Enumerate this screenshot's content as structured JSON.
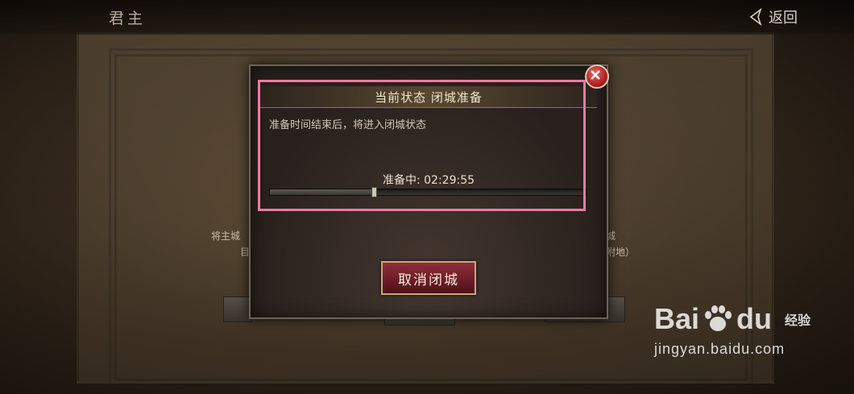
{
  "topbar": {
    "title": "君主",
    "back_label": "返回"
  },
  "background": {
    "left_text_1": "将主城",
    "left_text_2": "目",
    "right_text_1": "城",
    "right_text_2": "附地）"
  },
  "dialog": {
    "header": "当前状态 闭城准备",
    "description": "准备时间结束后，将进入闭城状态",
    "progress_label": "准备中: 02:29:55",
    "progress_fraction": 0.33,
    "cancel_button": "取消闭城"
  },
  "watermark": {
    "brand_left": "Bai",
    "brand_right": "du",
    "brand_sub": "经验",
    "url": "jingyan.baidu.com"
  },
  "colors": {
    "highlight": "#ef7aa0",
    "cancel_button": "#8e2f3a",
    "close_button": "#b3201f"
  }
}
